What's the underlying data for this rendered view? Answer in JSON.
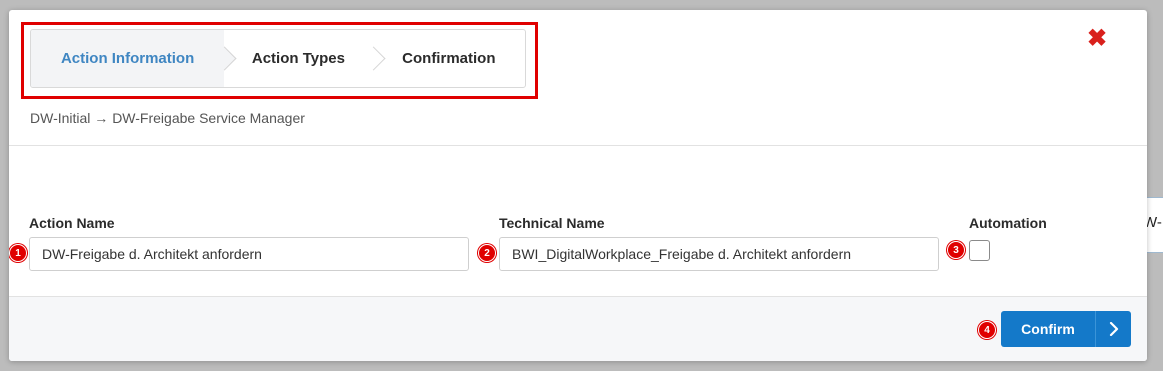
{
  "background": {
    "peek_text": "W-"
  },
  "stepper": {
    "steps": [
      {
        "label": "Action Information",
        "active": true
      },
      {
        "label": "Action Types",
        "active": false
      },
      {
        "label": "Confirmation",
        "active": false
      }
    ]
  },
  "close_icon": "close-x-icon",
  "breadcrumb": "DW-Initial → DW-Freigabe Service Manager",
  "form": {
    "action_name": {
      "label": "Action Name",
      "value": "DW-Freigabe d. Architekt anfordern"
    },
    "technical_name": {
      "label": "Technical Name",
      "value": "BWI_DigitalWorkplace_Freigabe d. Architekt anfordern"
    },
    "automation": {
      "label": "Automation",
      "checked": false
    }
  },
  "footer": {
    "confirm_label": "Confirm"
  },
  "markers": [
    "1",
    "2",
    "3",
    "4"
  ],
  "colors": {
    "accent": "#1479c9",
    "active_step_text": "#3f86c2",
    "highlight": "#e00000",
    "close": "#d9201c"
  }
}
